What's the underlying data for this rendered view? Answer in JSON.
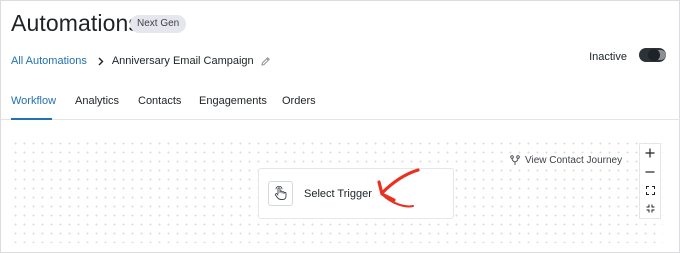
{
  "header": {
    "title": "Automations",
    "badge": "Next Gen"
  },
  "breadcrumb": {
    "root": "All Automations",
    "current": "Anniversary Email Campaign"
  },
  "status": {
    "label": "Inactive",
    "active": false
  },
  "tabs": [
    {
      "label": "Workflow",
      "active": true
    },
    {
      "label": "Analytics",
      "active": false
    },
    {
      "label": "Contacts",
      "active": false
    },
    {
      "label": "Engagements",
      "active": false
    },
    {
      "label": "Orders",
      "active": false
    }
  ],
  "canvas": {
    "view_journey": "View Contact Journey",
    "trigger_label": "Select Trigger"
  },
  "colors": {
    "accent": "#2271b1",
    "arrow": "#e8311f",
    "badge_bg": "#e6e6ee"
  }
}
